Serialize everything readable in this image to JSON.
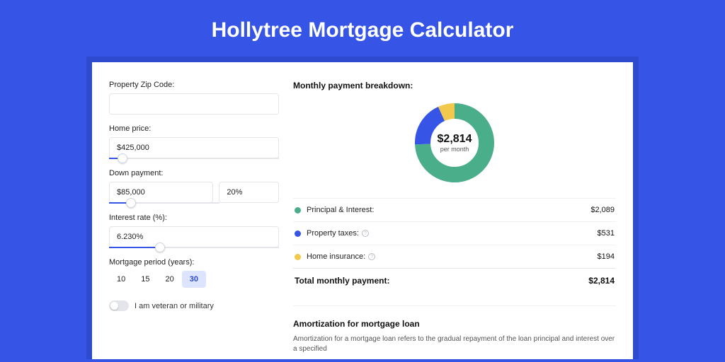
{
  "title": "Hollytree Mortgage Calculator",
  "form": {
    "zip": {
      "label": "Property Zip Code:",
      "value": ""
    },
    "home_price": {
      "label": "Home price:",
      "value": "$425,000",
      "slider_pct": 8
    },
    "down_payment": {
      "label": "Down payment:",
      "amount": "$85,000",
      "percent": "20%",
      "slider_pct": 20
    },
    "interest": {
      "label": "Interest rate (%):",
      "value": "6.230%",
      "slider_pct": 30
    },
    "period": {
      "label": "Mortgage period (years):",
      "options": [
        "10",
        "15",
        "20",
        "30"
      ],
      "active_index": 3
    },
    "veteran": {
      "label": "I am veteran or military",
      "checked": false
    }
  },
  "breakdown": {
    "title": "Monthly payment breakdown:",
    "donut": {
      "amount": "$2,814",
      "sub": "per month"
    },
    "items": [
      {
        "label": "Principal & Interest:",
        "value": "$2,089",
        "color": "#4bae8b",
        "info": false,
        "pct": 74.2
      },
      {
        "label": "Property taxes:",
        "value": "$531",
        "color": "#3654e6",
        "info": true,
        "pct": 18.9
      },
      {
        "label": "Home insurance:",
        "value": "$194",
        "color": "#f2c94c",
        "info": true,
        "pct": 6.9
      }
    ],
    "total": {
      "label": "Total monthly payment:",
      "value": "$2,814"
    }
  },
  "amortization": {
    "title": "Amortization for mortgage loan",
    "text": "Amortization for a mortgage loan refers to the gradual repayment of the loan principal and interest over a specified"
  },
  "chart_data": {
    "type": "pie",
    "title": "Monthly payment breakdown",
    "total_label": "$2,814 per month",
    "series": [
      {
        "name": "Principal & Interest",
        "value": 2089,
        "color": "#4bae8b"
      },
      {
        "name": "Property taxes",
        "value": 531,
        "color": "#3654e6"
      },
      {
        "name": "Home insurance",
        "value": 194,
        "color": "#f2c94c"
      }
    ]
  }
}
